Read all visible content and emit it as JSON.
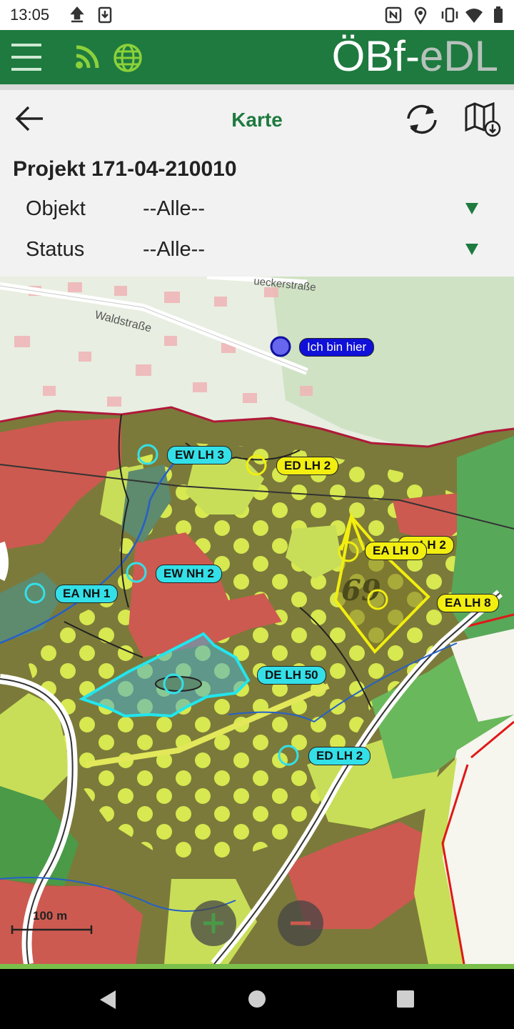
{
  "status_bar": {
    "time": "13:05"
  },
  "app": {
    "brand_main": "ÖBf-",
    "brand_sub": "eDL"
  },
  "toolbar": {
    "title": "Karte"
  },
  "project": {
    "label": "Projekt 171-04-210010"
  },
  "filters": {
    "objekt": {
      "label": "Objekt",
      "value": "--Alle--"
    },
    "status": {
      "label": "Status",
      "value": "--Alle--"
    }
  },
  "map": {
    "streets": {
      "street_1": "Waldstraße",
      "street_2": "ueckerstraße"
    },
    "you_are_here": "Ich bin hier",
    "markers": {
      "ew_lh_3": "EW LH 3",
      "ed_lh_2_top": "ED LH 2",
      "ea_lh_0": "EA LH 0",
      "lh_2_partial": "LH 2",
      "ew_nh_2": "EW NH 2",
      "ea_nh_1": "EA NH 1",
      "ea_lh_8": "EA LH 8",
      "de_lh_50": "DE LH 50",
      "ed_lh_2_bottom": "ED LH 2"
    },
    "stand_number": "69",
    "scale": "100 m"
  },
  "colors": {
    "primary": "#1e7a3f",
    "marker_cyan": "#33e0e8",
    "marker_yellow": "#f2ee10",
    "marker_blue": "#1010d8"
  },
  "icons": [
    "menu-icon",
    "rss-feed-icon",
    "globe-icon",
    "back-arrow-icon",
    "sync-icon",
    "map-download-icon",
    "zoom-in-icon",
    "zoom-out-icon"
  ]
}
